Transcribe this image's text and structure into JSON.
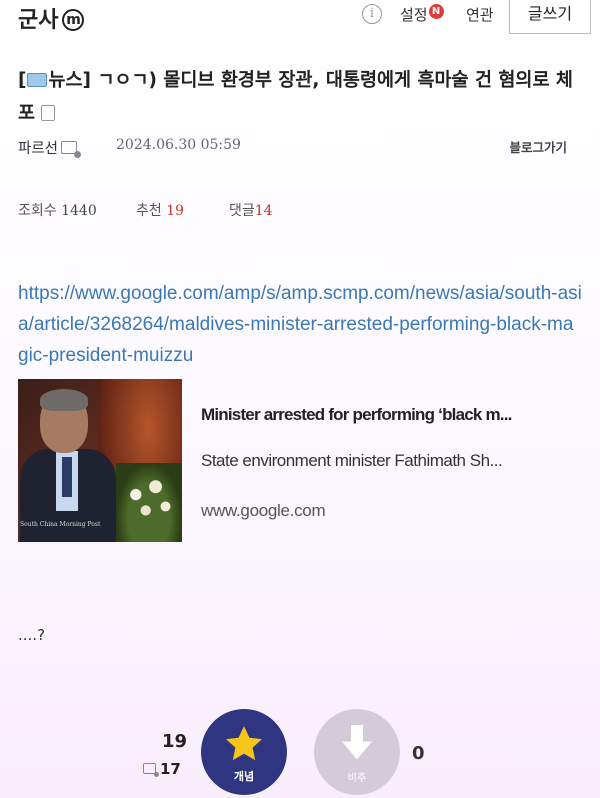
{
  "header": {
    "board_title": "군사",
    "board_badge": "m",
    "info_icon": "i",
    "settings_label": "설정",
    "settings_badge": "N",
    "related_label": "연관",
    "write_button": "글쓰기"
  },
  "post": {
    "title_prefix_open": "[",
    "title_prefix_label": "뉴스",
    "title_prefix_close": "]",
    "title_text": "ㄱㅇㄱ) 몰디브 환경부 장관, 대통령에게 흑마술 건 혐의로 체포",
    "author": "파르선",
    "date": "2024.06.30 05:59",
    "blog_link": "블로그가기",
    "stats": {
      "views_label": "조회수",
      "views": "1440",
      "recommend_label": "추천",
      "recommend": "19",
      "comments_label": "댓글",
      "comments": "14"
    },
    "url": "https://www.google.com/amp/s/amp.scmp.com/news/asia/south-asia/article/3268264/maldives-minister-arrested-performing-black-magic-president-muizzu",
    "link_card": {
      "title": "Minister arrested for performing ‘black m...",
      "description": "State environment minister Fathimath Sh...",
      "domain": "www.google.com",
      "thumbnail_caption": "South China Morning Post"
    },
    "body": "....?"
  },
  "votes": {
    "up_count": "19",
    "memo_count": "17",
    "upvote_label": "개념",
    "downvote_label": "비추",
    "down_count": "0"
  },
  "colors": {
    "upvote_bg": "#2f3580",
    "star": "#f5c518",
    "link": "#3a78b5",
    "comment_count": "#c0392b"
  },
  "icons": {
    "board_badge": "m-circle-icon",
    "info": "info-icon",
    "news_tv": "tv-icon",
    "attachment": "image-icon",
    "memo": "memo-icon",
    "upvote": "star-icon",
    "downvote": "down-arrow-icon"
  }
}
